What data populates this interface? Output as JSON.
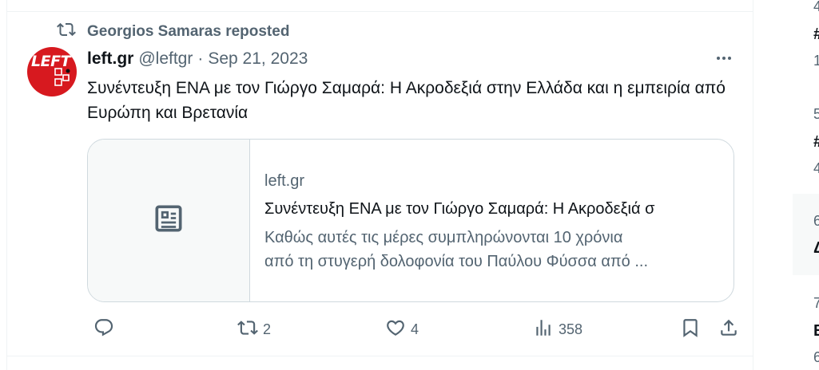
{
  "post": {
    "repost_context": "Georgios Samaras reposted",
    "author_name": "left.gr",
    "handle": "@leftgr",
    "separator": "·",
    "date": "Sep 21, 2023",
    "avatar_text": "LEFT",
    "text": "Συνέντευξη ΕΝΑ με τον Γιώργο Σαμαρά: Η Ακροδεξιά στην Ελλάδα και η εμπειρία από Ευρώπη και Βρετανία",
    "card": {
      "domain": "left.gr",
      "title": "Συνέντευξη ΕΝΑ με τον Γιώργο Σαμαρά: Η Ακροδεξιά σ",
      "description_line1": "Καθώς αυτές τις μέρες συμπληρώνονται 10 χρόνια",
      "description_line2": "από τη στυγερή δολοφονία του Παύλου Φύσσα από ..."
    },
    "actions": {
      "reply_count": "",
      "repost_count": "2",
      "like_count": "4",
      "view_count": "358"
    }
  },
  "icons": {
    "repost": "repost-icon",
    "more": "more-icon",
    "card_media": "article-icon",
    "reply": "reply-icon",
    "like": "heart-icon",
    "views": "analytics-icon",
    "bookmark": "bookmark-icon",
    "share": "share-icon"
  },
  "colors": {
    "text_primary": "#0f1419",
    "text_secondary": "#536471",
    "border": "#cfd9de",
    "avatar_bg": "#d7191f"
  },
  "sidebar_fragments": [
    {
      "text": "4",
      "bold": false
    },
    {
      "text": "#",
      "bold": true
    },
    {
      "text": "1",
      "bold": false
    },
    {
      "text": "5",
      "bold": false
    },
    {
      "text": "#",
      "bold": true
    },
    {
      "text": "4",
      "bold": false
    },
    {
      "text": "6",
      "bold": false
    },
    {
      "text": "Δ",
      "bold": true
    },
    {
      "text": "7",
      "bold": false
    },
    {
      "text": "E",
      "bold": true
    },
    {
      "text": "6",
      "bold": false
    }
  ]
}
